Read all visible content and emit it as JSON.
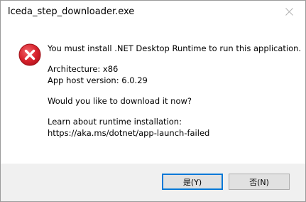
{
  "window": {
    "title": "lceda_step_downloader.exe"
  },
  "icons": {
    "close": "close-icon",
    "status": "error-icon"
  },
  "colors": {
    "error_red": "#d9232d",
    "accent_blue": "#0078d7",
    "footer_bg": "#f0f0f0"
  },
  "message": {
    "line1": "You must install .NET Desktop Runtime to run this application.",
    "line2": "Architecture: x86",
    "line3": "App host version: 6.0.29",
    "line4": "Would you like to download it now?",
    "line5": "Learn about runtime installation:",
    "line6": "https://aka.ms/dotnet/app-launch-failed"
  },
  "buttons": {
    "yes_label": "是(Y)",
    "no_label": "否(N)"
  }
}
